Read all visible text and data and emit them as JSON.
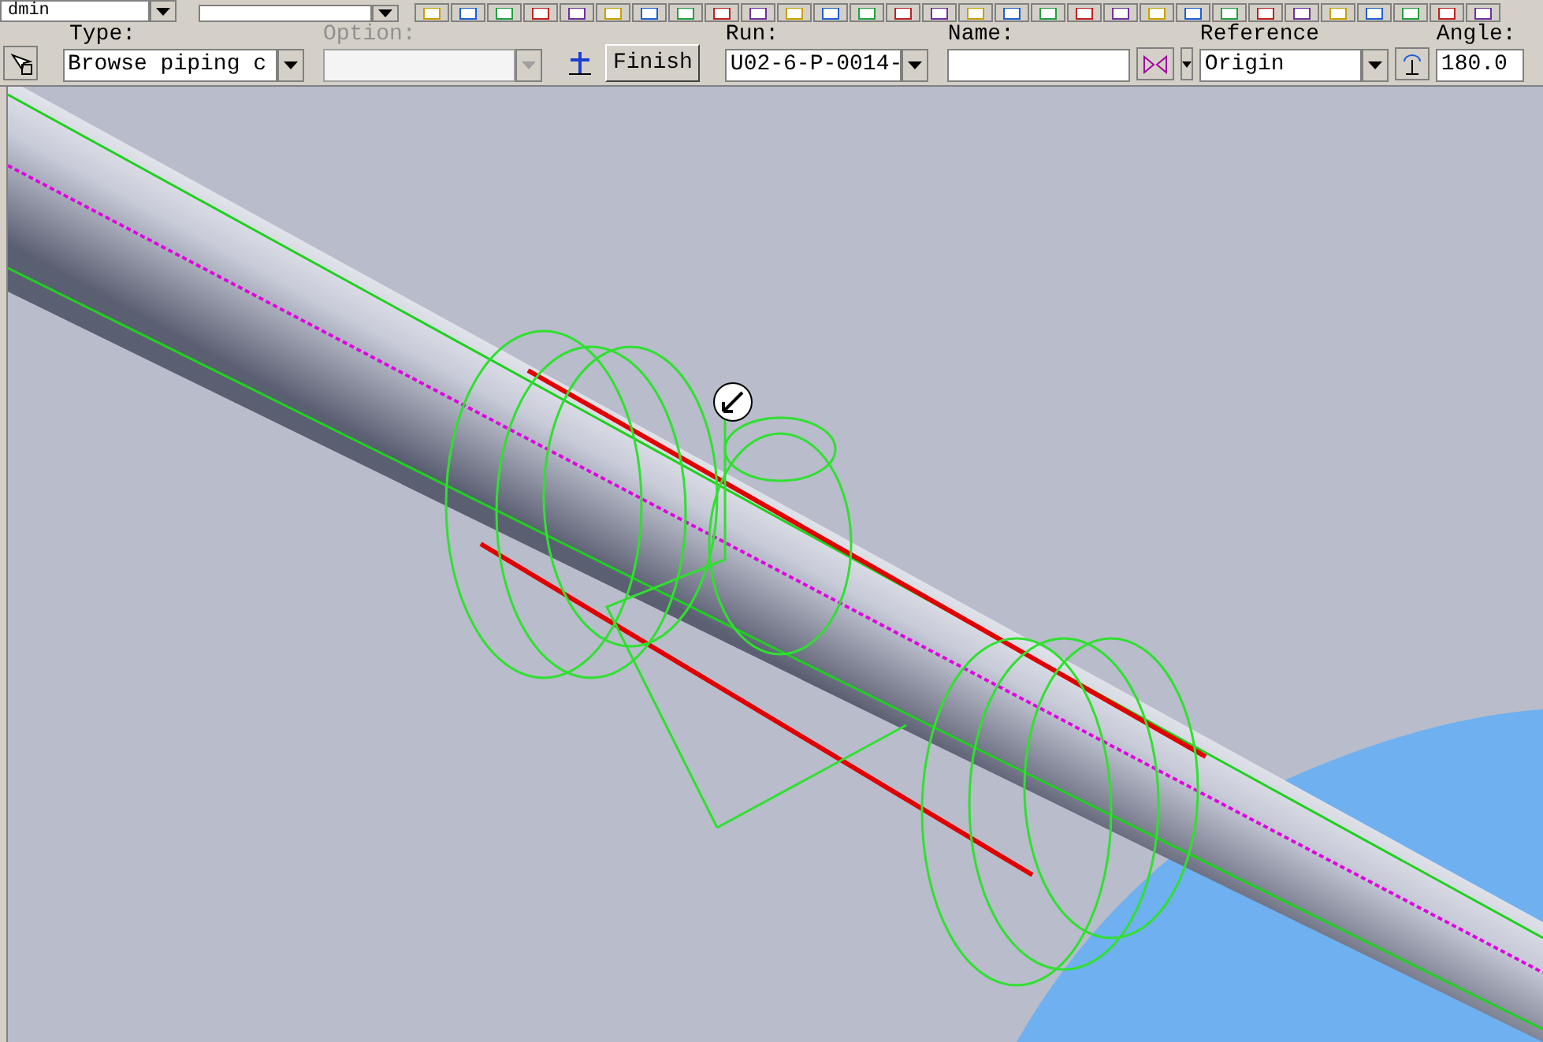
{
  "toolbar": {
    "combo_value": "dmin"
  },
  "route_bar": {
    "type": {
      "label": "Type:",
      "value": "Browse piping c"
    },
    "option": {
      "label": "Option:",
      "disabled": true
    },
    "finish": "Finish",
    "run": {
      "label": "Run:",
      "value": "U02-6-P-0014-"
    },
    "name": {
      "label": "Name:"
    },
    "reference": {
      "label": "Reference",
      "value": "Origin"
    },
    "angle": {
      "label": "Angle:",
      "value": "180.0"
    }
  }
}
